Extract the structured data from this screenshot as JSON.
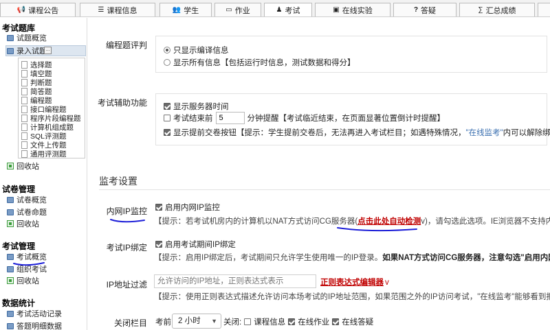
{
  "nav": {
    "tabs": [
      {
        "label": "课程公告",
        "icon": "megaphone-icon",
        "glyph": "📢"
      },
      {
        "label": "课程信息",
        "icon": "list-icon",
        "glyph": "☰"
      },
      {
        "label": "学生",
        "icon": "users-icon",
        "glyph": "👥"
      },
      {
        "label": "作业",
        "icon": "folder-icon",
        "glyph": "▭"
      },
      {
        "label": "考试",
        "icon": "exam-icon",
        "glyph": "♟"
      },
      {
        "label": "在线实验",
        "icon": "monitor-icon",
        "glyph": "▣"
      },
      {
        "label": "答疑",
        "icon": "question-icon",
        "glyph": "?"
      },
      {
        "label": "汇总成绩",
        "icon": "sigma-icon",
        "glyph": "∑"
      }
    ]
  },
  "sidebar": {
    "exam_bank": {
      "title": "考试题库",
      "overview": "试题概览",
      "enter": "录入试题",
      "more": "...",
      "types": [
        "选择题",
        "填空题",
        "判断题",
        "简答题",
        "编程题",
        "接口编程题",
        "程序片段编程题",
        "计算机组成题",
        "SQL评测题",
        "文件上传题",
        "通用评测题"
      ],
      "recycle": "回收站"
    },
    "paper_mgmt": {
      "title": "试卷管理",
      "items": [
        "试卷概览",
        "试卷命题",
        "回收站"
      ]
    },
    "exam_mgmt": {
      "title": "考试管理",
      "items": [
        "考试概览",
        "组织考试",
        "回收站"
      ]
    },
    "stats": {
      "title": "数据统计",
      "items": [
        "考试活动记录",
        "答题明细数据"
      ]
    }
  },
  "main": {
    "prog_review": {
      "label": "编程题评判",
      "opt1": "只显示编译信息",
      "opt2": "显示所有信息【包括运行时信息，测试数据和得分】"
    },
    "aux": {
      "label": "考试辅助功能",
      "show_time": "显示服务器时间",
      "end_pre": "考试结束前",
      "minutes": "5",
      "end_post": "分钟提醒【考试临近结束，在页面显著位置倒计时提醒】",
      "submit_btn": "显示提前交卷按钮【提示：学生提前交卷后，无法再进入考试栏目；如遇特殊情况，",
      "submit_link": "\"在线监考\"",
      "submit_tail": "内可以解除绑定】"
    },
    "proctor_title": "监考设置",
    "ip_monitor": {
      "label": "内网IP监控",
      "check": "启用内网IP监控",
      "hint_pre": "【提示：若考试机房内的计算机以NAT方式访问CG服务器(",
      "hint_link": "点击此处自动检测",
      "hint_post": "v)，请勾选此选项。IE浏览器不支持内网IP获取"
    },
    "ip_bind": {
      "label": "考试IP绑定",
      "check": "启用考试期间IP绑定",
      "hint_pre": "【提示：启用IP绑定后，考试期间只允许学生使用唯一的IP登录。",
      "hint_bold": "如果NAT方式访问CG服务器，注意勾选\"启用内网IP监控\"",
      "hint_end": "。"
    },
    "ip_filter": {
      "label": "IP地址过滤",
      "placeholder": "允许访问的IP地址，正则表达式表示",
      "editor": "正则表达式编辑器",
      "editor_arrow": "v",
      "hint": "【提示：使用正则表达式描述允许访问本场考试的IP地址范围，如果范围之外的IP访问考试，\"在线监考\"能够看到报警信息】"
    },
    "close_cols": {
      "label": "关闭栏目",
      "before": "考前",
      "select": "2 小时",
      "close": "关闭:",
      "c1": "课程信息",
      "c2": "在线作业",
      "c3": "在线答疑"
    }
  },
  "colors": {
    "accent_link": "#3a6fb0",
    "red_link": "#c00000",
    "annotation": "#1d1fd8"
  }
}
